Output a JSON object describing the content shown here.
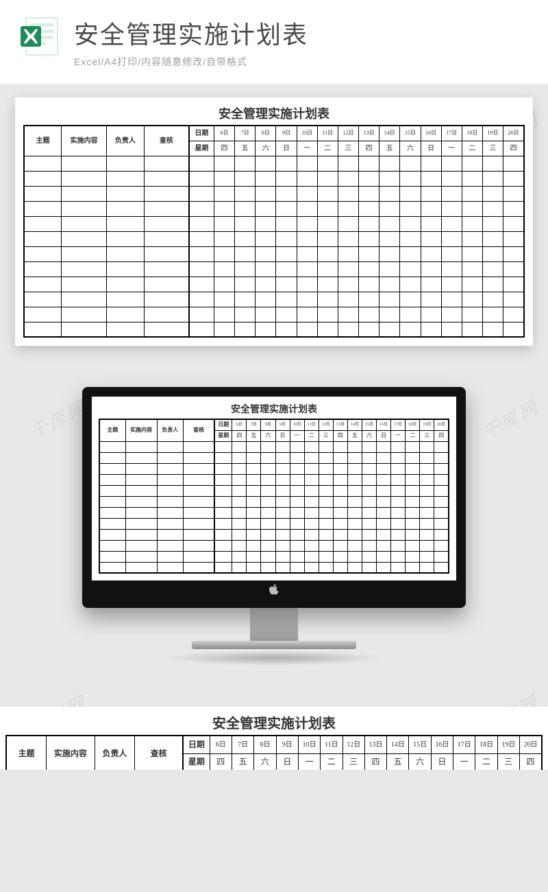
{
  "header": {
    "title": "安全管理实施计划表",
    "subtitle": "Excel/A4打印/内容随意修改/自带格式"
  },
  "watermark": "千库网",
  "sheet": {
    "title": "安全管理实施计划表",
    "info_headers": [
      "主题",
      "实施内容",
      "负责人",
      "查核"
    ],
    "row_labels": [
      "日期",
      "星期"
    ],
    "dates": [
      "6日",
      "7日",
      "8日",
      "9日",
      "10日",
      "11日",
      "12日",
      "13日",
      "14日",
      "15日",
      "16日",
      "17日",
      "18日",
      "19日",
      "20日"
    ],
    "weekdays": [
      "四",
      "五",
      "六",
      "日",
      "一",
      "二",
      "三",
      "四",
      "五",
      "六",
      "日",
      "一",
      "二",
      "三",
      "四"
    ],
    "empty_rows": 12
  }
}
